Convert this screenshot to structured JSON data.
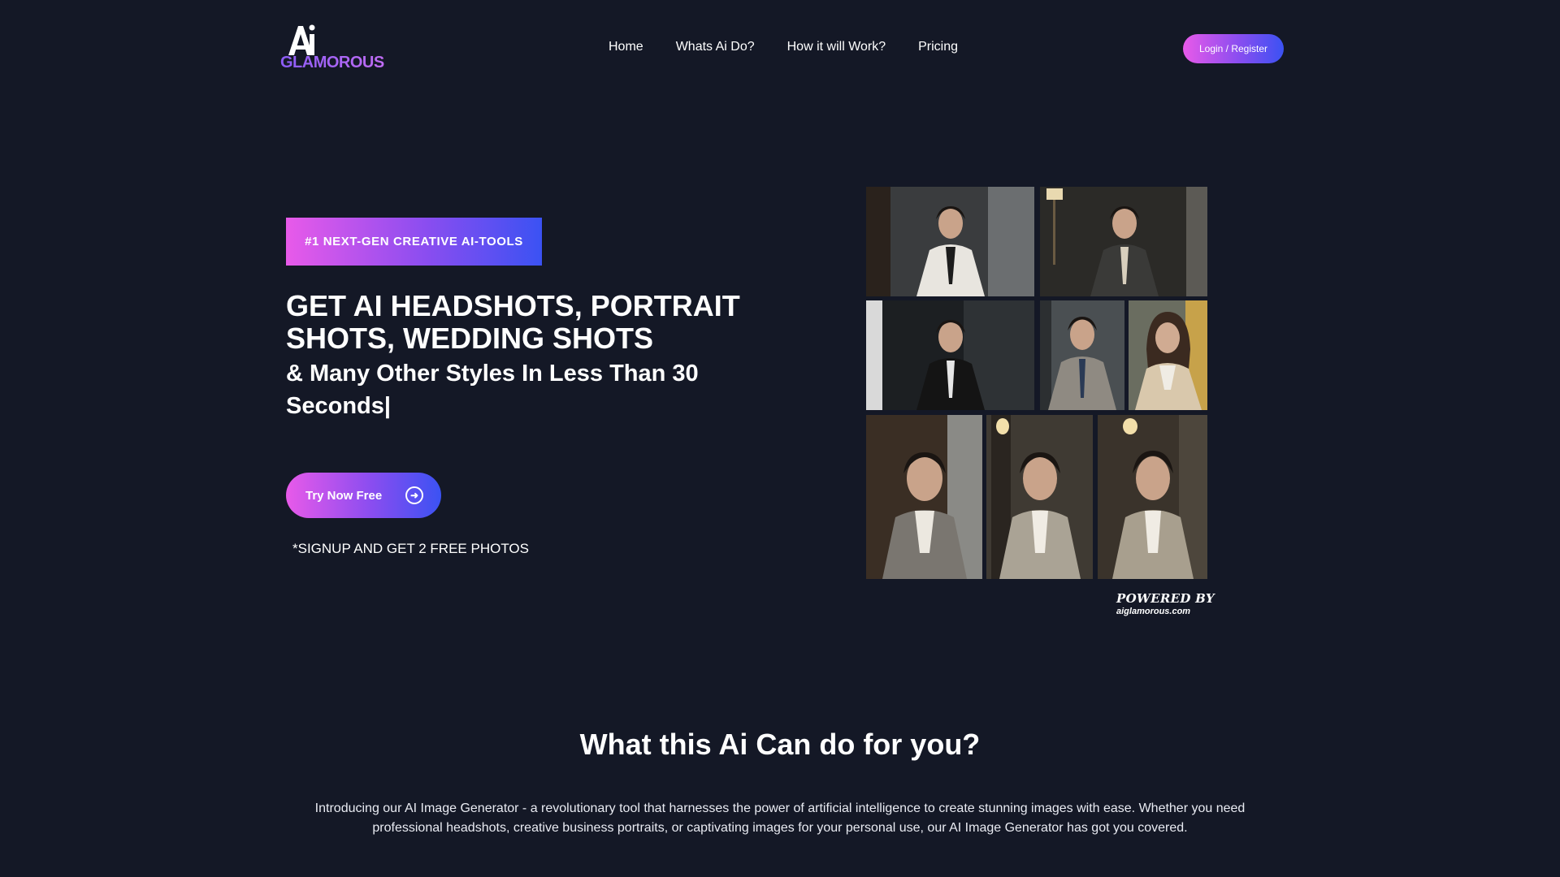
{
  "header": {
    "logo": {
      "mark": "Ai",
      "word": "GLAMOROUS"
    },
    "nav": [
      "Home",
      "Whats Ai Do?",
      "How it will Work?",
      "Pricing"
    ],
    "login_label": "Login / Register"
  },
  "hero": {
    "badge": "#1 NEXT-GEN CREATIVE AI-TOOLS",
    "headline": "GET AI HEADSHOTS, PORTRAIT SHOTS, WEDDING SHOTS",
    "subline": "& Many Other Styles In Less Than 30 Seconds|",
    "cta_label": "Try Now Free",
    "note": "*SIGNUP AND GET 2 FREE PHOTOS",
    "powered_by": "POWERED BY",
    "powered_site": "aiglamorous.com"
  },
  "features": {
    "title": "What this Ai Can do for you?",
    "description": "Introducing our AI Image Generator - a revolutionary tool that harnesses the power of artificial intelligence to create stunning images with ease. Whether you need professional headshots, creative business portraits, or captivating images for your personal use, our AI Image Generator has got you covered."
  },
  "colors": {
    "background": "#141826",
    "gradient_start": "#e85ae9",
    "gradient_end": "#3b52f3"
  },
  "icons": [
    "arrow-right-circle-icon"
  ]
}
